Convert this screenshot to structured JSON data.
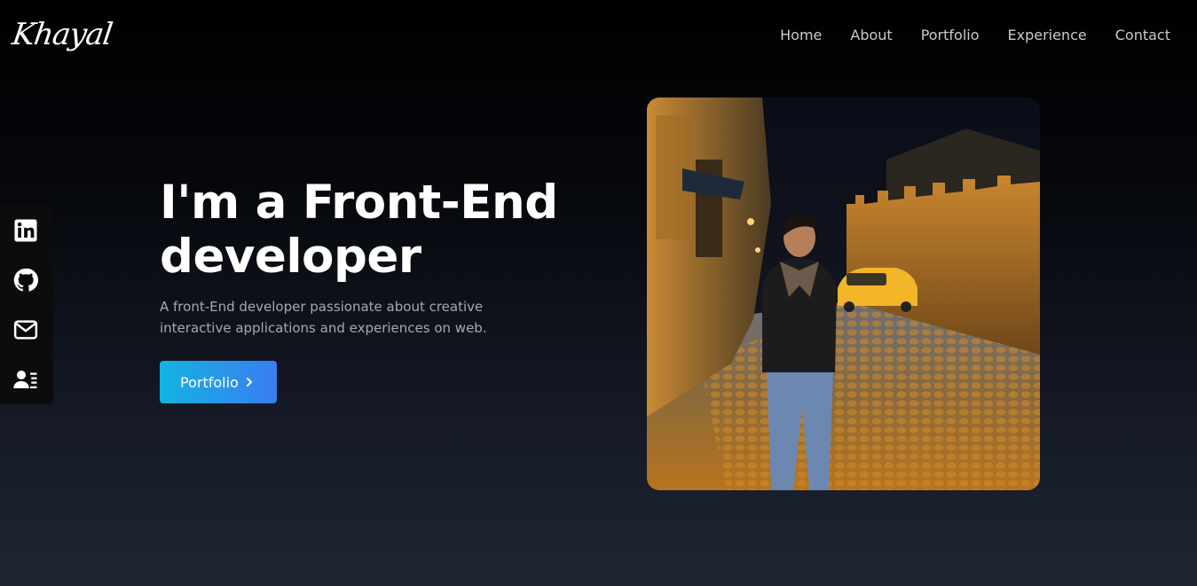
{
  "brand": {
    "logo_text": "Khayal"
  },
  "nav": {
    "items": [
      {
        "label": "Home"
      },
      {
        "label": "About"
      },
      {
        "label": "Portfolio"
      },
      {
        "label": "Experience"
      },
      {
        "label": "Contact"
      }
    ]
  },
  "social": {
    "items": [
      {
        "icon": "linkedin-icon"
      },
      {
        "icon": "github-icon"
      },
      {
        "icon": "mail-icon"
      },
      {
        "icon": "resume-icon"
      }
    ]
  },
  "hero": {
    "title_line1": "I'm a Front-End",
    "title_line2": "developer",
    "description": "A front-End developer passionate about creative interactive applications and experiences on web.",
    "cta_label": "Portfolio",
    "cta_icon": "chevron-right-icon"
  },
  "colors": {
    "accent_start": "#12b3e0",
    "accent_end": "#3b7df2",
    "background": "#000000",
    "nav_text": "#c9c9cf"
  }
}
